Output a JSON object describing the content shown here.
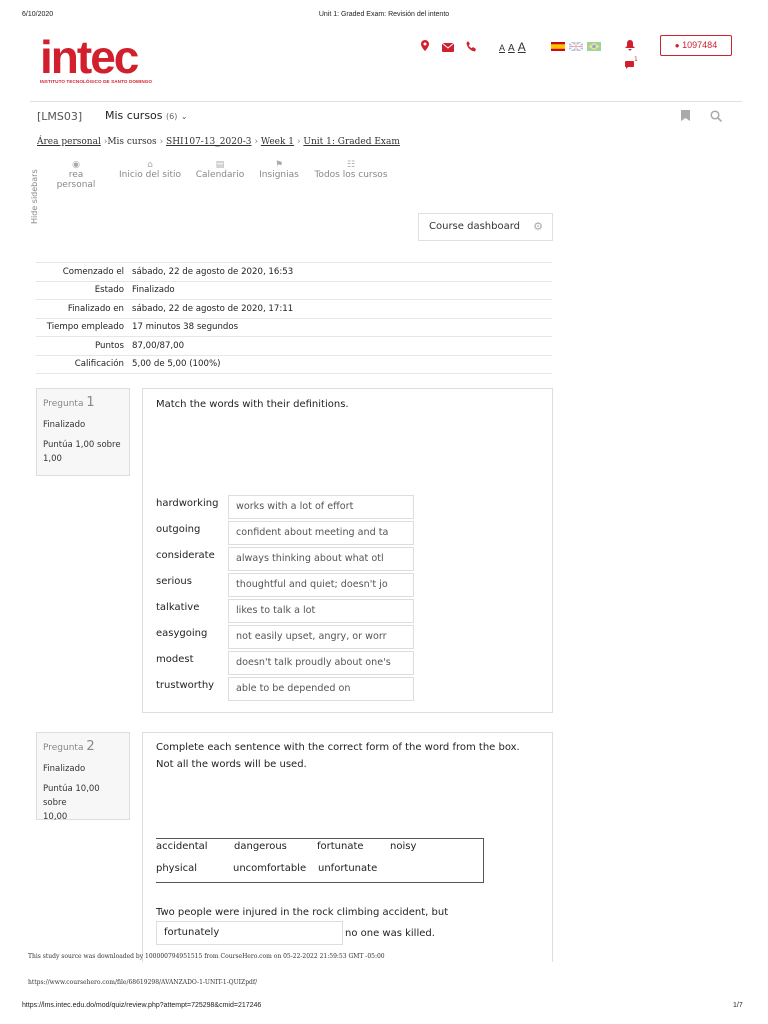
{
  "print_header": {
    "date": "6/10/2020",
    "title": "Unit 1: Graded Exam: Revisión del intento"
  },
  "logo": {
    "word": "intec",
    "subtitle": "INSTITUTO TECNOLÓGICO DE SANTO DOMINGO"
  },
  "header": {
    "icons": [
      "map-marker-icon",
      "envelope-icon",
      "phone-icon",
      "bell-icon",
      "chat-icon"
    ],
    "font_sizes": [
      "A",
      "A",
      "A"
    ],
    "user_id": "1097484",
    "chat_count": "1",
    "accent_color": "#d11f2d"
  },
  "nav": {
    "course_code": "[LMS03]",
    "my_courses": "Mis cursos",
    "my_courses_count": "(6)"
  },
  "breadcrumb": {
    "personal_area": "Área personal",
    "my_courses": "Mis cursos",
    "course": "SHI107-13_2020-3",
    "week": "Week 1",
    "exam": "Unit 1: Graded Exam"
  },
  "sidebar": {
    "hide_label": "Hide sidebars"
  },
  "menu": [
    {
      "label": "rea personal"
    },
    {
      "label": "Inicio del sitio"
    },
    {
      "label": "Calendario"
    },
    {
      "label": "Insignias"
    },
    {
      "label": "Todos los cursos"
    }
  ],
  "dashboard_button": "Course dashboard",
  "summary": [
    {
      "key": "Comenzado el",
      "value": "sábado, 22 de agosto de 2020, 16:53"
    },
    {
      "key": "Estado",
      "value": "Finalizado"
    },
    {
      "key": "Finalizado en",
      "value": "sábado, 22 de agosto de 2020, 17:11"
    },
    {
      "key": "Tiempo empleado",
      "value": "17 minutos 38 segundos"
    },
    {
      "key": "Puntos",
      "value": "87,00/87,00"
    },
    {
      "key": "Calificación",
      "value": "5,00 de 5,00 (100%)"
    }
  ],
  "q1": {
    "label": "Pregunta",
    "number": "1",
    "state": "Finalizado",
    "score_line1": "Puntúa 1,00 sobre",
    "score_line2": "1,00",
    "prompt": "Match the words with their definitions.",
    "pairs": [
      {
        "word": "hardworking",
        "answer": "works with a lot of effort"
      },
      {
        "word": "outgoing",
        "answer": "confident about meeting and ta"
      },
      {
        "word": "considerate",
        "answer": "always thinking about what otl"
      },
      {
        "word": "serious",
        "answer": "thoughtful and quiet; doesn't jo"
      },
      {
        "word": "talkative",
        "answer": "likes to talk a lot"
      },
      {
        "word": "easygoing",
        "answer": "not easily upset, angry, or worr"
      },
      {
        "word": "modest",
        "answer": "doesn't talk proudly about one's"
      },
      {
        "word": "trustworthy",
        "answer": "able to be depended on"
      }
    ]
  },
  "q2": {
    "label": "Pregunta",
    "number": "2",
    "state": "Finalizado",
    "score_line1": "Puntúa 10,00 sobre",
    "score_line2": "10,00",
    "prompt_line1": "Complete each sentence with the correct form of the word from the box.",
    "prompt_line2": "Not all the words will be used.",
    "words_row1": [
      "accidental",
      "dangerous",
      "fortunate",
      "noisy"
    ],
    "words_row2": [
      "physical",
      "uncomfortable",
      "unfortunate"
    ],
    "sentence_start": "Two people were injured in the rock climbing accident, but",
    "answer": "fortunately",
    "sentence_end": "no one was killed."
  },
  "footer": {
    "source_note": "This study source was downloaded by 100000794951515 from CourseHero.com on 05-22-2022 21:59:53 GMT -05:00",
    "source_url": "https://www.coursehero.com/file/68619298/AVANZADO-1-UNIT-1-QUIZpdf/",
    "page_url": "https://lms.intec.edu.do/mod/quiz/review.php?attempt=725298&cmid=217246",
    "page_number": "1/7"
  }
}
